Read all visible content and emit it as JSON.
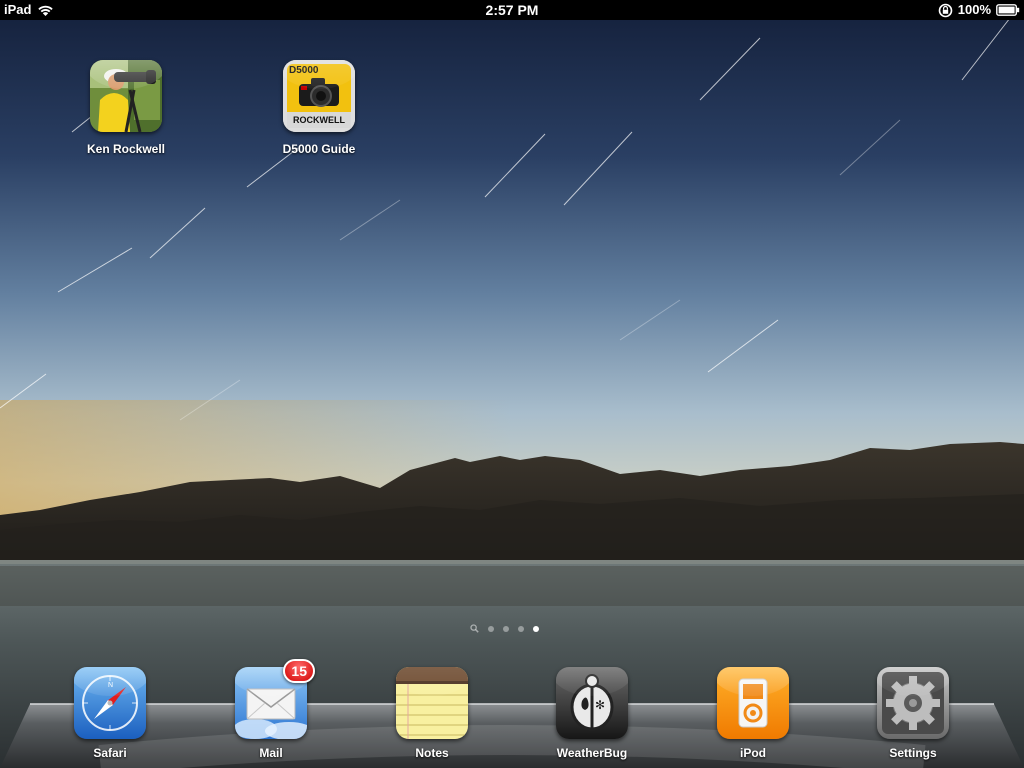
{
  "status_bar": {
    "device": "iPad",
    "time": "2:57 PM",
    "battery": "100%",
    "icons": [
      "wifi-icon",
      "rotation-lock-icon",
      "battery-icon"
    ]
  },
  "home_screen": {
    "apps": [
      {
        "label": "Ken Rockwell",
        "icon": "ken-rockwell-photo-icon"
      },
      {
        "label": "D5000 Guide",
        "icon": "d5000-camera-icon",
        "icon_text_top": "D5000",
        "icon_text_bottom": "ROCKWELL"
      }
    ],
    "page_count": 5,
    "active_page": 4
  },
  "dock": {
    "apps": [
      {
        "label": "Safari",
        "icon": "safari-compass-icon"
      },
      {
        "label": "Mail",
        "icon": "mail-envelope-icon",
        "badge": "15"
      },
      {
        "label": "Notes",
        "icon": "notes-notepad-icon"
      },
      {
        "label": "WeatherBug",
        "icon": "weatherbug-icon"
      },
      {
        "label": "iPod",
        "icon": "ipod-icon"
      },
      {
        "label": "Settings",
        "icon": "settings-gear-icon"
      }
    ]
  },
  "colors": {
    "sky_top": "#1c2c4c",
    "sky_bottom": "#c9d8e3",
    "mountain": "#2e2a24",
    "water": "#4c5558",
    "badge": "#d10000"
  }
}
